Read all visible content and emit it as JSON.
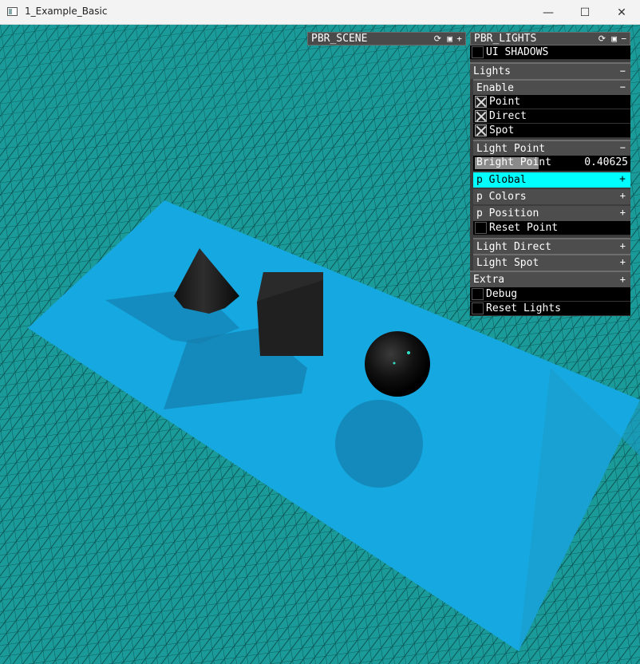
{
  "window": {
    "title": "1_Example_Basic",
    "controls": {
      "minimize": "—",
      "maximize": "☐",
      "close": "✕"
    }
  },
  "scene_panel": {
    "title": "PBR_SCENE",
    "icons": [
      "refresh-icon",
      "save-icon",
      "expand-icon"
    ]
  },
  "lights_panel": {
    "title": "PBR_LIGHTS",
    "ui_shadows": {
      "label": "UI SHADOWS",
      "checked": false
    },
    "lights_group": "Lights",
    "enable": {
      "label": "Enable",
      "items": [
        {
          "label": "Point",
          "checked": true
        },
        {
          "label": "Direct",
          "checked": true
        },
        {
          "label": "Spot",
          "checked": true
        }
      ]
    },
    "light_point": {
      "label": "Light Point",
      "bright": {
        "label": "Bright Point",
        "value": "0.40625",
        "fraction": 0.40625
      },
      "global": "p Global",
      "colors": "p Colors",
      "position": "p Position",
      "reset": "Reset Point"
    },
    "light_direct": "Light Direct",
    "light_spot": "Light Spot",
    "extra": {
      "label": "Extra",
      "debug": "Debug",
      "reset_lights": "Reset Lights"
    },
    "plus": "+",
    "minus": "−"
  },
  "colors": {
    "background": "#1a9a98",
    "plane": "#16a8e0",
    "highlight": "#00ffff"
  }
}
